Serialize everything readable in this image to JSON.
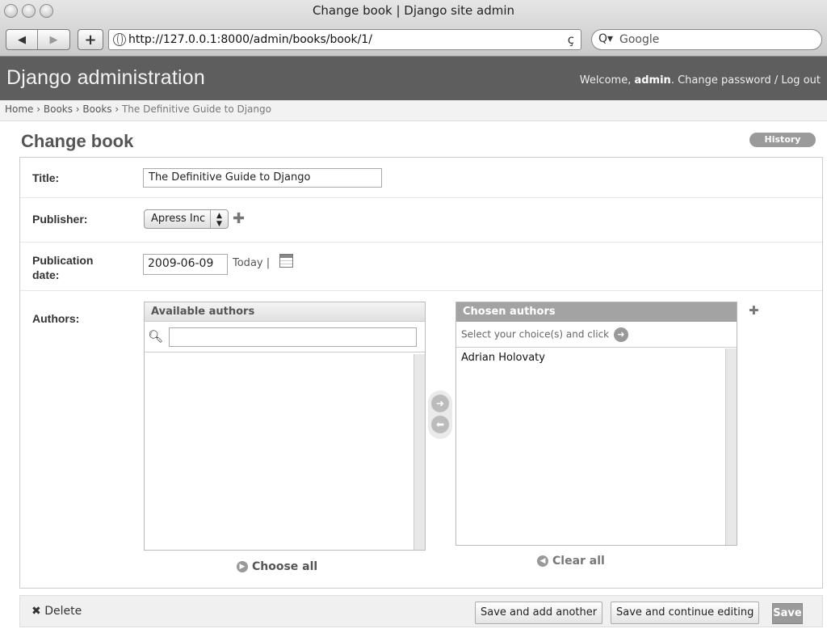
{
  "window": {
    "title": "Change book | Django site admin"
  },
  "browser": {
    "back": "◀",
    "forward": "▶",
    "add": "+",
    "url": "http://127.0.0.1:8000/admin/books/book/1/",
    "reload": "ç",
    "search_placeholder": "Google",
    "search_icon": "Q▾"
  },
  "header": {
    "branding": "Django administration",
    "welcome": "Welcome, ",
    "user": "admin",
    "links": ". Change password / Log out"
  },
  "breadcrumbs": {
    "path": "Home › Books › Books › ",
    "current": "The Definitive Guide to Django"
  },
  "page": {
    "title": "Change book",
    "history": "History"
  },
  "form": {
    "title_label": "Title:",
    "title_value": "The Definitive Guide to Django",
    "publisher_label": "Publisher:",
    "publisher_value": "Apress Inc",
    "publication_label": "Publication date:",
    "date_value": "2009-06-09",
    "today_link": "Today |",
    "authors_label": "Authors:",
    "available_title": "Available authors",
    "chosen_title": "Chosen authors",
    "chosen_help": "Select your choice(s) and click",
    "chosen_items": [
      "Adrian Holovaty"
    ],
    "choose_all": "Choose all",
    "clear_all": "Clear all"
  },
  "submit": {
    "delete": "Delete",
    "save_add": "Save and add another",
    "save_continue": "Save and continue editing",
    "save": "Save"
  }
}
